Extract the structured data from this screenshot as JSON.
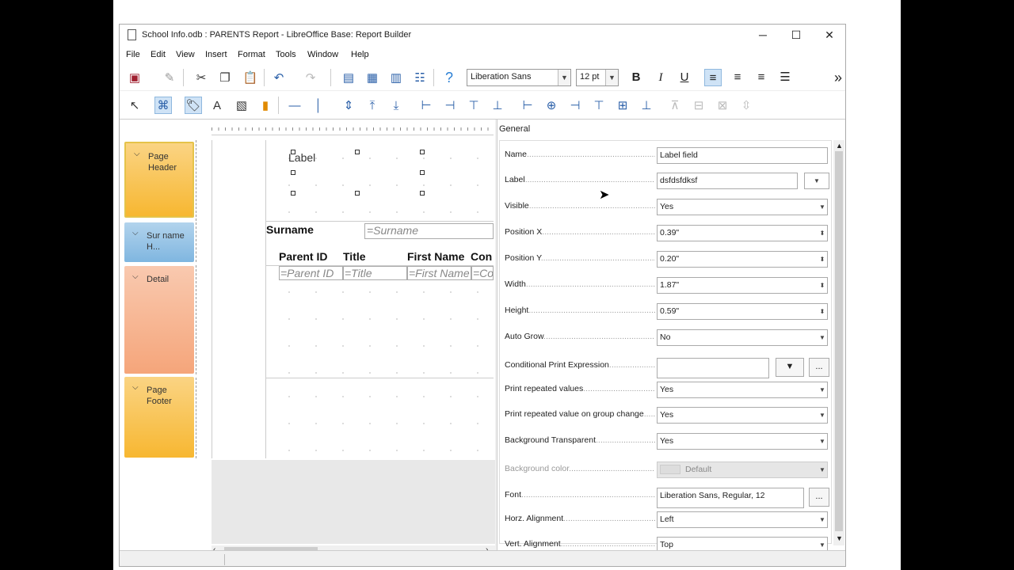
{
  "window": {
    "title": "School Info.odb : PARENTS Report - LibreOffice Base: Report Builder"
  },
  "menu": [
    "File",
    "Edit",
    "View",
    "Insert",
    "Format",
    "Tools",
    "Window",
    "Help"
  ],
  "toolbar": {
    "font_name": "Liberation Sans",
    "font_size": "12 pt",
    "bold": "B",
    "italic": "I",
    "underline": "U",
    "more": "»"
  },
  "sections": [
    {
      "label": "Page Header",
      "color": "#f7b731"
    },
    {
      "label": "Sur name H...",
      "color": "#7fb6e0"
    },
    {
      "label": "Detail",
      "color": "#f5a57a"
    },
    {
      "label": "Page Footer",
      "color": "#f7b731"
    }
  ],
  "design": {
    "label_text": "Label",
    "group_header_label": "Surname",
    "group_header_field": "=Surname",
    "col_headers": [
      "Parent ID",
      "Title",
      "First Name",
      "Con"
    ],
    "detail_fields": [
      "=Parent ID",
      "=Title",
      "=First Name",
      "=Co"
    ]
  },
  "properties": {
    "tab": "General",
    "rows": [
      {
        "label": "Name",
        "value": "Label field"
      },
      {
        "label": "Label",
        "value": "dsfdsfdksf"
      },
      {
        "label": "Visible",
        "value": "Yes"
      },
      {
        "label": "Position X",
        "value": "0.39\""
      },
      {
        "label": "Position Y",
        "value": "0.20\""
      },
      {
        "label": "Width",
        "value": "1.87\""
      },
      {
        "label": "Height",
        "value": "0.59\""
      },
      {
        "label": "Auto Grow",
        "value": "No"
      },
      {
        "label": "Conditional Print Expression",
        "value": ""
      },
      {
        "label": "Print repeated values",
        "value": "Yes"
      },
      {
        "label": "Print repeated value on group change",
        "value": "Yes"
      },
      {
        "label": "Background Transparent",
        "value": "Yes"
      },
      {
        "label": "Background color",
        "value": "Default"
      },
      {
        "label": "Font",
        "value": "Liberation Sans, Regular, 12"
      },
      {
        "label": "Horz. Alignment",
        "value": "Left"
      },
      {
        "label": "Vert. Alignment",
        "value": "Top"
      }
    ],
    "ellipsis": "..."
  }
}
